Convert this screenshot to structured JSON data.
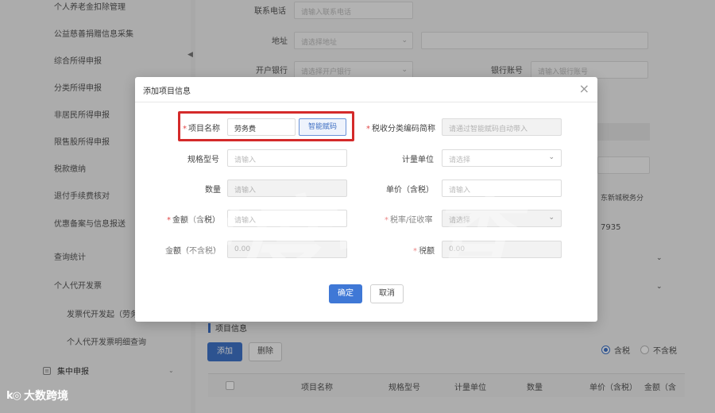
{
  "sidebar": {
    "items": [
      {
        "label": "个人养老金扣除管理"
      },
      {
        "label": "公益慈善捐赠信息采集"
      },
      {
        "label": "综合所得申报"
      },
      {
        "label": "分类所得申报"
      },
      {
        "label": "非居民所得申报"
      },
      {
        "label": "限售股所得申报"
      },
      {
        "label": "税款缴纳"
      },
      {
        "label": "退付手续费核对"
      },
      {
        "label": "优惠备案与信息报送"
      },
      {
        "label": "查询统计"
      },
      {
        "label": "个人代开发票"
      }
    ],
    "sub_items": [
      {
        "label": "发票代开发起（劳务"
      },
      {
        "label": "个人代开发票明细查询"
      }
    ],
    "group": {
      "label": "集中申报",
      "icon": "list-icon"
    }
  },
  "form_bg": {
    "phone_label": "联系电话",
    "phone_placeholder": "请输入联系电话",
    "address_label": "地址",
    "address_placeholder": "请选择地址",
    "bank_label": "开户银行",
    "bank_placeholder": "请选择开户银行",
    "account_label": "银行账号",
    "account_placeholder": "请输入银行账号",
    "ghost_text_1": "东新城税务分",
    "ghost_text_2": "7935"
  },
  "items_section": {
    "title": "项目信息",
    "add_label": "添加",
    "delete_label": "删除",
    "radio_tax_incl": "含税",
    "radio_tax_excl": "不含税",
    "columns": [
      "项目名称",
      "规格型号",
      "计量单位",
      "数量",
      "单价（含税）",
      "金额（含"
    ]
  },
  "modal": {
    "title": "添加项目信息",
    "close_icon": "×",
    "item_name_label": "项目名称",
    "item_name_value": "劳务费",
    "smart_code_label": "智能赋码",
    "tax_code_label": "税收分类编码简称",
    "tax_code_placeholder": "请通过智能赋码自动带入",
    "spec_label": "规格型号",
    "spec_placeholder": "请输入",
    "unit_label": "计量单位",
    "unit_placeholder": "请选择",
    "qty_label": "数量",
    "qty_placeholder": "请输入",
    "price_label": "单价（含税）",
    "price_placeholder": "请输入",
    "amount_incl_label": "金额（含税）",
    "amount_incl_placeholder": "请输入",
    "rate_label": "税率/征收率",
    "rate_placeholder": "请选择",
    "amount_excl_label": "金额（不含税）",
    "amount_excl_value": "0.00",
    "tax_label": "税额",
    "tax_value": "0.00",
    "ok_label": "确定",
    "cancel_label": "取消",
    "required_mark": "*"
  },
  "watermark": "深度抽查",
  "brand": {
    "logo": "k◎",
    "name": "大数跨境"
  },
  "colors": {
    "primary": "#3f78d6",
    "highlight": "#d42a2a",
    "required": "#e24848"
  }
}
